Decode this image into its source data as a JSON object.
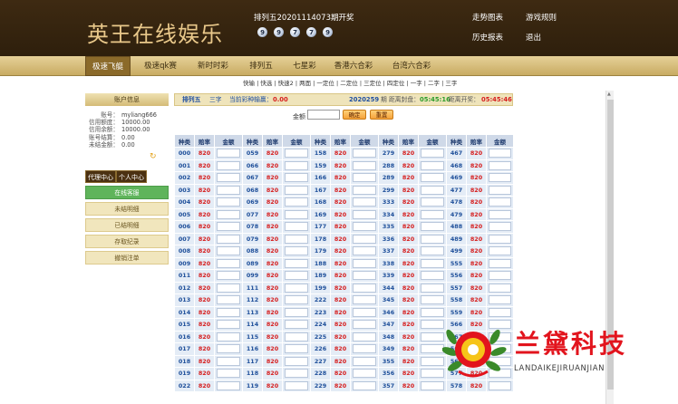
{
  "header": {
    "logo": "英王在线娱乐",
    "issue": "排列五20201114073期开奖",
    "balls": [
      "9",
      "9",
      "7",
      "7",
      "9"
    ],
    "links": [
      "走势图表",
      "游戏规则",
      "历史报表",
      "退出"
    ]
  },
  "nav": {
    "items": [
      "极速飞艇",
      "极速qk赛",
      "新时时彩",
      "排列五",
      "七星彩",
      "香港六合彩",
      "台湾六合彩"
    ],
    "active": "极速飞艇"
  },
  "subnav": "快输 | 快选 | 快速2 | 两面 | 一定位 | 二定位 | 三定位 | 四定位 | 一字 | 二字 | 三字",
  "sidebar": {
    "title": "账户信息",
    "account": [
      {
        "k": "账号：",
        "v": "myliang666"
      },
      {
        "k": "信用额度：",
        "v": "10000.00"
      },
      {
        "k": "信用余额：",
        "v": "10000.00"
      },
      {
        "k": "账号结算：",
        "v": "0.00"
      },
      {
        "k": "未结金额：",
        "v": "0.00"
      }
    ],
    "tabs": [
      "代理中心",
      "个人中心"
    ],
    "menu": [
      "在线客服",
      "未结明细",
      "已结明细",
      "存取纪录",
      "撤销注单"
    ],
    "active_menu": "在线客服"
  },
  "infobar": {
    "game": "排列五",
    "mode": "三字",
    "win_label": "当前彩种输赢：",
    "win_value": "0.00",
    "period": "2020259",
    "close_label": "期 距离封盘：",
    "close_time": "05:45:16",
    "open_label": "距离开奖：",
    "open_time": "05:45:46"
  },
  "amount": {
    "label": "金额",
    "confirm": "确定",
    "reset": "重置"
  },
  "table": {
    "headers": [
      "种类",
      "赔率",
      "金额"
    ],
    "odds": "820",
    "columns": [
      [
        "000",
        "001",
        "002",
        "003",
        "004",
        "005",
        "006",
        "007",
        "008",
        "009",
        "011",
        "012",
        "013",
        "014",
        "015",
        "016",
        "017",
        "018",
        "019",
        "022"
      ],
      [
        "059",
        "066",
        "067",
        "068",
        "069",
        "077",
        "078",
        "079",
        "088",
        "089",
        "099",
        "111",
        "112",
        "113",
        "114",
        "115",
        "116",
        "117",
        "118",
        "119"
      ],
      [
        "158",
        "159",
        "166",
        "167",
        "168",
        "169",
        "177",
        "178",
        "179",
        "188",
        "189",
        "199",
        "222",
        "223",
        "224",
        "225",
        "226",
        "227",
        "228",
        "229"
      ],
      [
        "279",
        "288",
        "289",
        "299",
        "333",
        "334",
        "335",
        "336",
        "337",
        "338",
        "339",
        "344",
        "345",
        "346",
        "347",
        "348",
        "349",
        "355",
        "356",
        "357"
      ],
      [
        "467",
        "468",
        "469",
        "477",
        "478",
        "479",
        "488",
        "489",
        "499",
        "555",
        "556",
        "557",
        "558",
        "559",
        "566",
        "567",
        "568",
        "569",
        "577",
        "578"
      ]
    ]
  },
  "watermark": {
    "text": "兰黛科技",
    "sub": "LANDAIKEJIRUANJIAN",
    "colors": {
      "red": "#e2141d",
      "green": "#3a8a2a",
      "yellow": "#f6c419"
    }
  }
}
